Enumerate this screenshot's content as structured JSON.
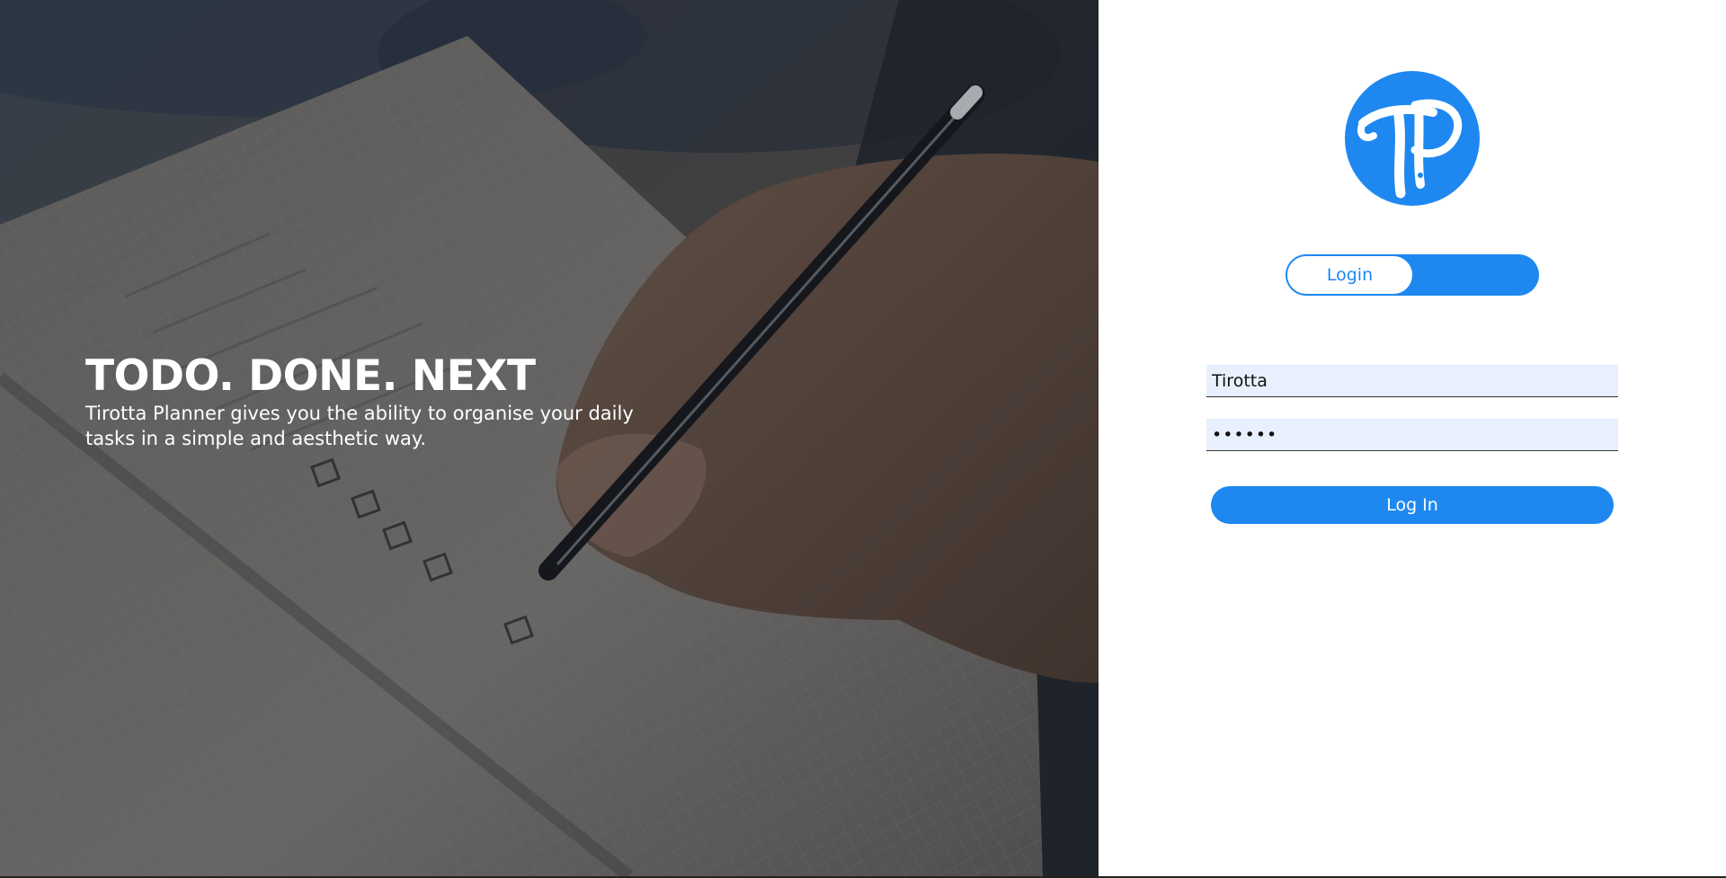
{
  "hero": {
    "title": "TODO. DONE. NEXT",
    "subtitle": "Tirotta Planner gives you the ability to organise your daily tasks in a simple and aesthetic way."
  },
  "auth": {
    "logo_icon": "tp-monogram-logo",
    "mode_toggle": {
      "active_label": "Login"
    },
    "username": {
      "value": "Tirotta"
    },
    "password": {
      "value": "••••••"
    },
    "submit_label": "Log In"
  },
  "colors": {
    "accent": "#1e88f0",
    "field_background": "#e8f0fe",
    "hero_text": "#ffffff",
    "background": "#ffffff"
  }
}
